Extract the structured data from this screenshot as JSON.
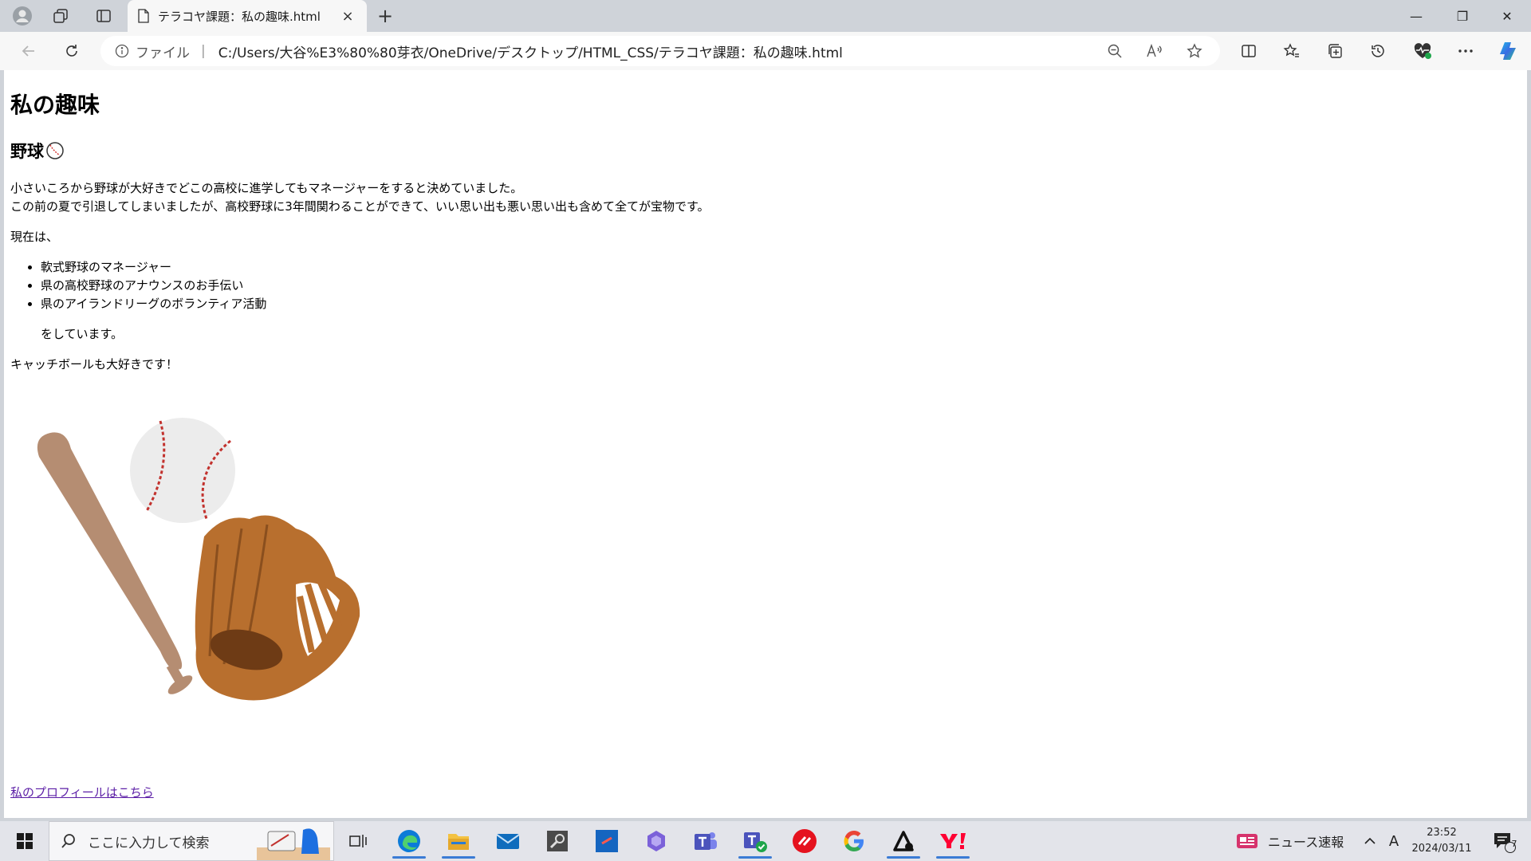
{
  "browser": {
    "tab_title": "テラコヤ課題：私の趣味.html",
    "tab_close": "×",
    "new_tab": "+",
    "address_label": "ファイル",
    "address_sep": "|",
    "url": "C:/Users/大谷%E3%80%80芽衣/OneDrive/デスクトップ/HTML_CSS/テラコヤ課題：私の趣味.html",
    "window_controls": {
      "minimize": "—",
      "restore": "❐",
      "close": "✕"
    }
  },
  "page": {
    "h1": "私の趣味",
    "h2": "野球",
    "para1_line1": "小さいころから野球が大好きでどこの高校に進学してもマネージャーをすると決めていました。",
    "para1_line2": "この前の夏で引退してしまいましたが、高校野球に3年間関わることができて、いい思い出も悪い思い出も含めて全てが宝物です。",
    "para2": "現在は、",
    "list": [
      "軟式野球のマネージャー",
      "県の高校野球のアナウンスのお手伝い",
      "県のアイランドリーグのボランティア活動"
    ],
    "after_list": "をしています。",
    "para3": "キャッチボールも大好きです！",
    "link": "私のプロフィールはこちら"
  },
  "taskbar": {
    "search_placeholder": "ここに入力して検索",
    "news": "ニュース速報",
    "ime": "A",
    "time": "23:52",
    "date": "2024/03/11",
    "notification_count": "7",
    "tray_chevron": "^"
  },
  "colors": {
    "link": "#5b1da6",
    "edge_blue": "#0c7bd8",
    "bat": "#b58d72",
    "glove": "#b86f2e",
    "seam": "#c2322e"
  }
}
